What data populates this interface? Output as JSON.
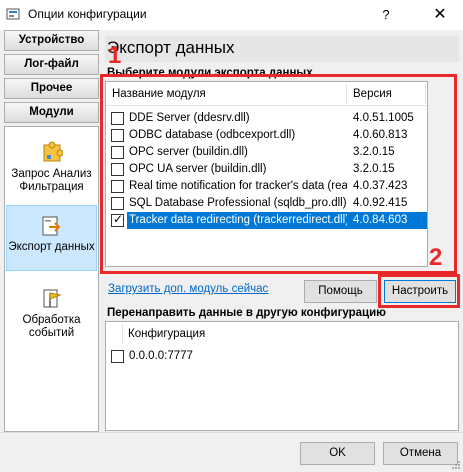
{
  "window": {
    "title": "Опции конфигурации",
    "help_label": "?",
    "close_label": "✕"
  },
  "nav": {
    "tabs": [
      "Устройство",
      "Лог-файл",
      "Прочее",
      "Модули"
    ],
    "items": [
      {
        "label": "Запрос Анализ Фильтрация",
        "icon": "module-puzzle-icon"
      },
      {
        "label": "Экспорт данных",
        "icon": "export-data-icon",
        "selected": true
      },
      {
        "label": "Обработка событий",
        "icon": "event-flag-icon"
      }
    ]
  },
  "main": {
    "heading": "Экспорт данных",
    "group_label": "Выберите модули экспорта данных",
    "columns": [
      "Название модуля",
      "Версия"
    ],
    "modules": [
      {
        "name": "DDE Server (ddesrv.dll)",
        "version": "4.0.51.1005",
        "checked": false
      },
      {
        "name": "ODBC database (odbcexport.dll)",
        "version": "4.0.60.813",
        "checked": false
      },
      {
        "name": "OPC server (buildin.dll)",
        "version": "3.2.0.15",
        "checked": false
      },
      {
        "name": "OPC UA server (buildin.dll)",
        "version": "3.2.0.15",
        "checked": false
      },
      {
        "name": "Real time notification for tracker's data (realt...",
        "version": "4.0.37.423",
        "checked": false
      },
      {
        "name": "SQL Database Professional (sqldb_pro.dll)",
        "version": "4.0.92.415",
        "checked": false
      },
      {
        "name": "Tracker data redirecting (trackerredirect.dll)",
        "version": "4.0.84.603",
        "checked": true,
        "selected": true
      }
    ],
    "link": "Загрузить доп. модуль сейчас",
    "help_button": "Помощь",
    "configure_button": "Настроить",
    "redirect_label": "Перенаправить данные в другую конфигурацию",
    "redirect_columns": [
      "Конфигурация"
    ],
    "redirect_rows": [
      {
        "name": "0.0.0.0:7777",
        "checked": false
      }
    ]
  },
  "annotations": [
    "1",
    "2"
  ],
  "footer": {
    "ok_button": "OK",
    "cancel_button": "Отмена"
  },
  "colors": {
    "accent": "#0078d7",
    "annotation": "#e8282b",
    "link": "#0066cc"
  }
}
